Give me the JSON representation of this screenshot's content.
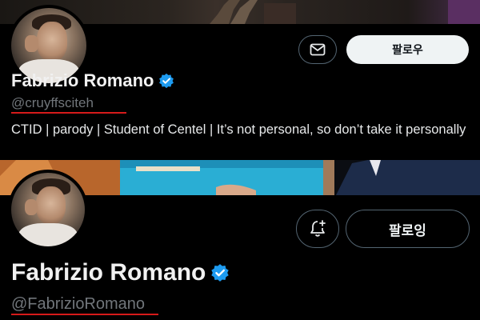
{
  "profiles": [
    {
      "display_name": "Fabrizio Romano",
      "handle": "@cruyffsciteh",
      "bio": "CTID | parody | Student of Centel | It’s not personal, so don’t take it personally",
      "follow_label": "팔로우",
      "action_icon": "mail-icon",
      "verified_color": "#1d9bf0"
    },
    {
      "display_name": "Fabrizio Romano",
      "handle": "@FabrizioRomano",
      "follow_label": "팔로잉",
      "action_icon": "notification-add-icon",
      "verified_color": "#1d9bf0"
    }
  ],
  "colors": {
    "highlight_underline": "#d61a1a",
    "secondary_text": "#71767b"
  }
}
